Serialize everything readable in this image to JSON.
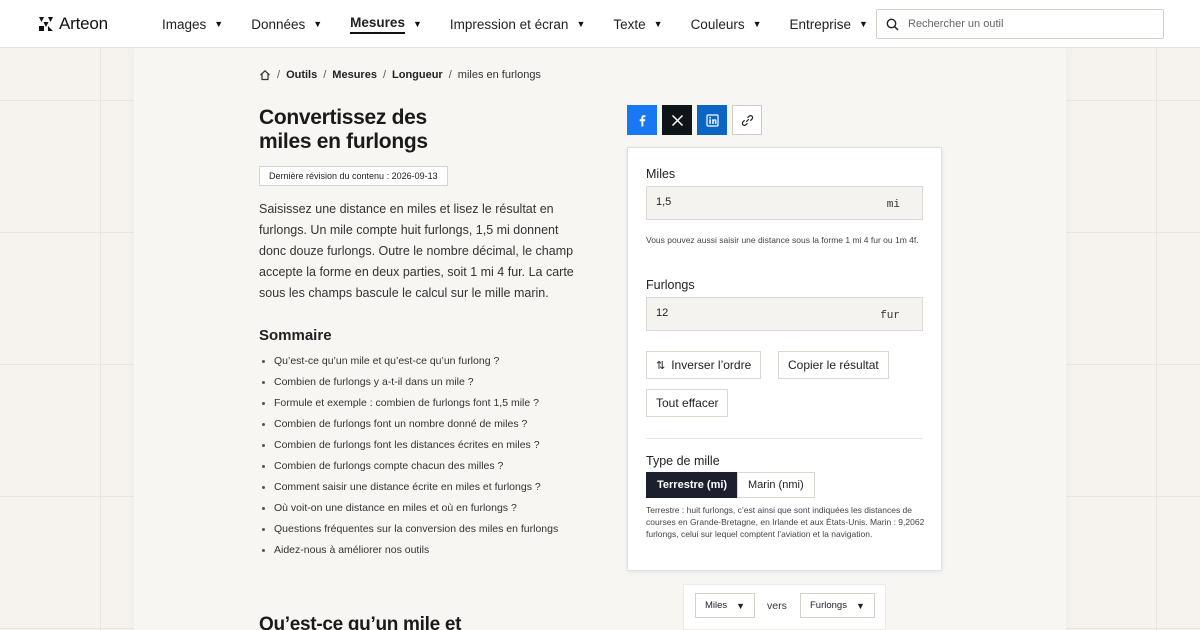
{
  "brand": {
    "name": "Arteon"
  },
  "nav": {
    "items": [
      {
        "label": "Images"
      },
      {
        "label": "Données"
      },
      {
        "label": "Mesures"
      },
      {
        "label": "Impression et écran"
      },
      {
        "label": "Texte"
      },
      {
        "label": "Couleurs"
      },
      {
        "label": "Entreprise"
      }
    ],
    "active": "Mesures",
    "caret": "▼"
  },
  "search": {
    "placeholder": "Rechercher un outil"
  },
  "breadcrumb": {
    "separator": "/",
    "items": [
      "Outils",
      "Mesures",
      "Longueur",
      "miles en furlongs"
    ]
  },
  "page": {
    "title_line1": "Convertissez des",
    "title_line2": "miles en furlongs",
    "revision": "Dernière révision du contenu : 2026-09-13",
    "intro": "Saisissez une distance en miles et lisez le résultat en furlongs. Un mile compte huit furlongs, 1,5 mi donnent donc douze furlongs. Outre le nombre décimal, le champ accepte la forme en deux parties, soit 1 mi 4 fur. La carte sous les champs bascule le calcul sur le mille marin.",
    "toc_title": "Sommaire",
    "toc": [
      "Qu’est-ce qu’un mile et qu’est-ce qu’un furlong ?",
      "Combien de furlongs y a-t-il dans un mile ?",
      "Formule et exemple : combien de furlongs font 1,5 mile ?",
      "Combien de furlongs font un nombre donné de miles ?",
      "Combien de furlongs font les distances écrites en miles ?",
      "Combien de furlongs compte chacun des milles ?",
      "Comment saisir une distance écrite en miles et furlongs ?",
      "Où voit-on une distance en miles et où en furlongs ?",
      "Questions fréquentes sur la conversion des miles en furlongs",
      "Aidez-nous à améliorer nos outils"
    ],
    "section_title": "Qu’est-ce qu’un mile et"
  },
  "share": {
    "icons": [
      "facebook-icon",
      "x-icon",
      "linkedin-icon",
      "link-icon"
    ],
    "colors": {
      "facebook": "#1877f2",
      "x": "#0f1419",
      "linkedin": "#0a66c2"
    }
  },
  "converter": {
    "miles_label": "Miles",
    "miles_value": "1,5",
    "miles_unit": "mi",
    "hint": "Vous pouvez aussi saisir une distance sous la forme 1 mi 4 fur ou 1m 4f.",
    "furlongs_label": "Furlongs",
    "furlongs_value": "12",
    "furlongs_unit": "fur",
    "swap_label": "Inverser l’ordre",
    "copy_label": "Copier le résultat",
    "clear_label": "Tout effacer",
    "mile_type_label": "Type de mille",
    "type_terrestrial": "Terrestre (mi)",
    "type_nautical": "Marin (nmi)",
    "type_selected": "Terrestre (mi)",
    "type_note": "Terrestre : huit furlongs, c’est ainsi que sont indiquées les distances de courses en Grande-Bretagne, en Irlande et aux États-Unis. Marin : 9,2062 furlongs, celui sur lequel comptent l’aviation et la navigation.",
    "accent_color": "#1c1f2e"
  },
  "unit_selector": {
    "from": "Miles",
    "connector": "vers",
    "to": "Furlongs"
  }
}
